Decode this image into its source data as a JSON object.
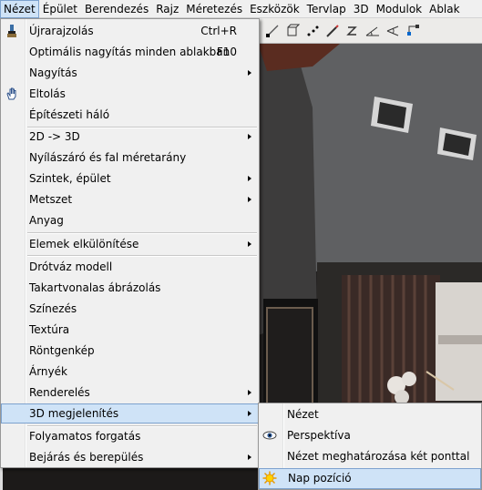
{
  "menubar": {
    "items": [
      "Nézet",
      "Épület",
      "Berendezés",
      "Rajz",
      "Méretezés",
      "Eszközök",
      "Tervlap",
      "3D",
      "Modulok",
      "Ablak"
    ]
  },
  "toolbar": {
    "icons": [
      "dimension-icon",
      "box-dimension-icon",
      "point-dimension-icon",
      "edit-dimension-icon",
      "dimension-z-icon",
      "angle-icon",
      "angle-arc-icon",
      "level-icon"
    ]
  },
  "menu": {
    "items": [
      {
        "label": "Újrarajzolás",
        "shortcut": "Ctrl+R",
        "icon": "brush-icon"
      },
      {
        "label": "Optimális nagyítás minden ablakban",
        "shortcut": "F10"
      },
      {
        "label": "Nagyítás",
        "submenu": true
      },
      {
        "label": "Eltolás",
        "icon": "hand-icon"
      },
      {
        "label": "Építészeti háló"
      },
      {
        "label": "2D -> 3D",
        "submenu": true
      },
      {
        "label": "Nyílászáró és fal méretarány"
      },
      {
        "label": "Szintek, épület",
        "submenu": true
      },
      {
        "label": "Metszet",
        "submenu": true
      },
      {
        "label": "Anyag"
      },
      {
        "label": "Elemek elkülönítése",
        "submenu": true
      },
      {
        "label": "Drótváz modell"
      },
      {
        "label": "Takartvonalas ábrázolás"
      },
      {
        "label": "Színezés"
      },
      {
        "label": "Textúra"
      },
      {
        "label": "Röntgenkép"
      },
      {
        "label": "Árnyék"
      },
      {
        "label": "Renderelés",
        "submenu": true
      },
      {
        "label": "3D megjelenítés",
        "submenu": true,
        "highlighted": true
      },
      {
        "label": "Folyamatos forgatás"
      },
      {
        "label": "Bejárás és berepülés",
        "submenu": true
      }
    ]
  },
  "submenu": {
    "items": [
      {
        "label": "Nézet"
      },
      {
        "label": "Perspektíva",
        "icon": "eye-icon"
      },
      {
        "label": "Nézet meghatározása két ponttal"
      },
      {
        "label": "Nap pozíció",
        "icon": "sun-icon",
        "highlighted": true
      }
    ]
  },
  "colors": {
    "highlight": "#cfe3f7",
    "highlight_border": "#7da2ce",
    "menu_bg": "#f0f0f0"
  }
}
